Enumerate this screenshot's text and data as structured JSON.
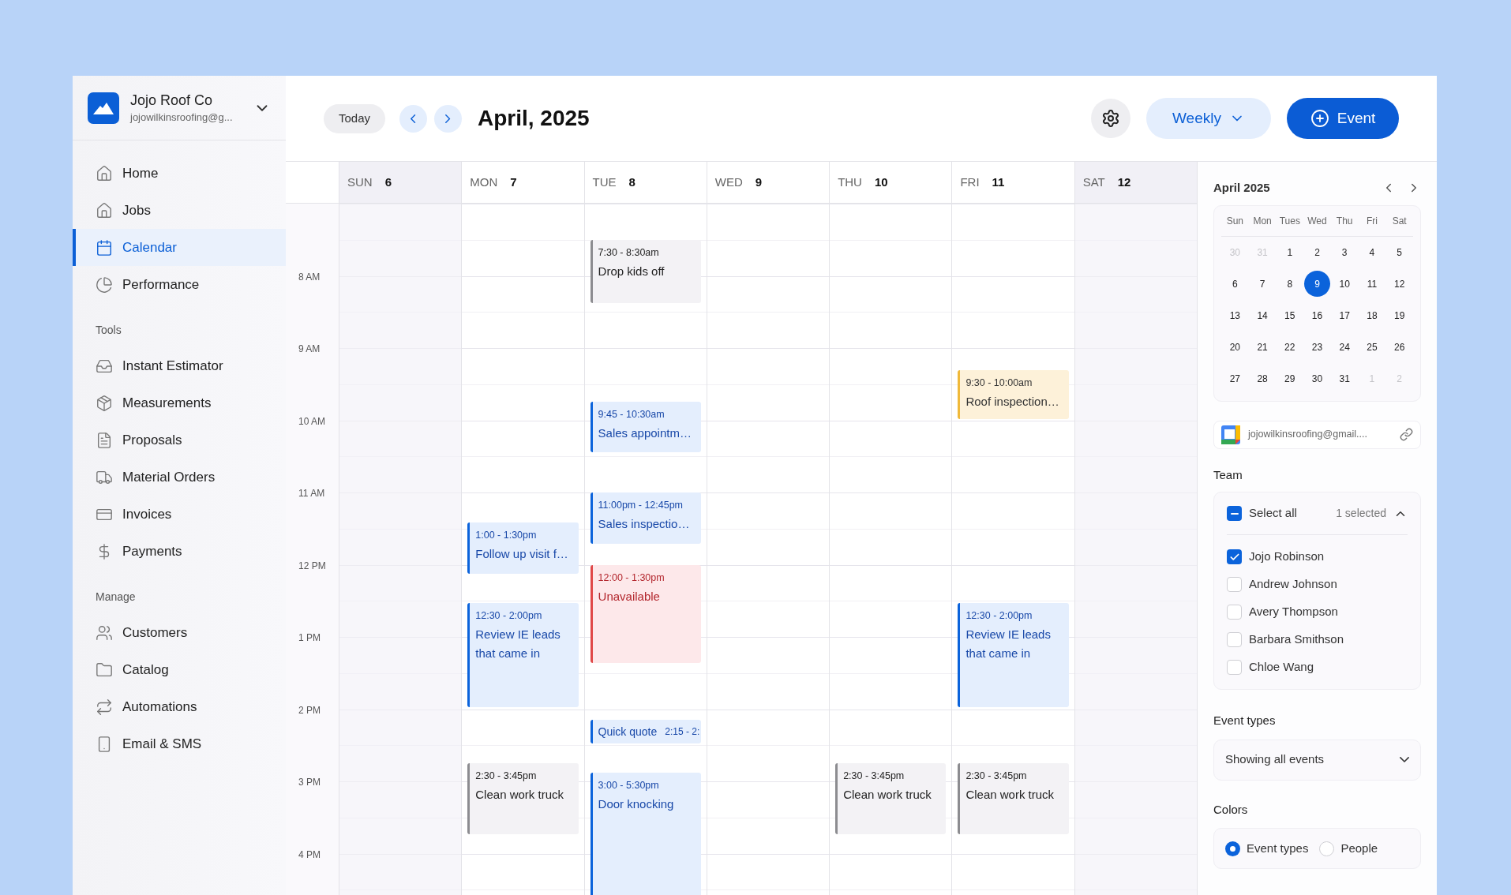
{
  "account": {
    "name": "Jojo Roof Co",
    "email": "jojowilkinsroofing@g..."
  },
  "nav": [
    {
      "items": [
        {
          "label": "Home",
          "selected": false
        },
        {
          "label": "Jobs",
          "selected": false
        },
        {
          "label": "Calendar",
          "selected": true
        },
        {
          "label": "Performance",
          "selected": false
        }
      ]
    },
    {
      "heading": "Tools",
      "items": [
        {
          "label": "Instant Estimator",
          "selected": false
        },
        {
          "label": "Measurements",
          "selected": false
        },
        {
          "label": "Proposals",
          "selected": false
        },
        {
          "label": "Material Orders",
          "selected": false
        },
        {
          "label": "Invoices",
          "selected": false
        },
        {
          "label": "Payments",
          "selected": false
        }
      ]
    },
    {
      "heading": "Manage",
      "items": [
        {
          "label": "Customers",
          "selected": false
        },
        {
          "label": "Catalog",
          "selected": false
        },
        {
          "label": "Automations",
          "selected": false
        },
        {
          "label": "Email & SMS",
          "selected": false
        }
      ]
    }
  ],
  "toolbar": {
    "today": "Today",
    "title": "April, 2025",
    "view": "Weekly",
    "add": "Event"
  },
  "hours": [
    "8 AM",
    "9 AM",
    "10 AM",
    "11 AM",
    "12 PM",
    "1 PM",
    "2 PM",
    "3 PM",
    "4 PM"
  ],
  "days": [
    {
      "name": "SUN",
      "date": "6",
      "weekend": true
    },
    {
      "name": "MON",
      "date": "7",
      "weekend": false,
      "events": [
        {
          "kind": "blue",
          "time": "1:00 - 1:30pm",
          "title": "Follow up visit f…"
        },
        {
          "kind": "blue",
          "time": "12:30 - 2:00pm",
          "title": "Review IE leads that came in"
        },
        {
          "kind": "gray",
          "time": "2:30 - 3:45pm",
          "title": "Clean work truck"
        }
      ]
    },
    {
      "name": "TUE",
      "date": "8",
      "weekend": false,
      "events": [
        {
          "kind": "gray",
          "time": "7:30 - 8:30am",
          "title": "Drop kids off"
        },
        {
          "kind": "blue",
          "time": "9:45 - 10:30am",
          "title": "Sales appointm…"
        },
        {
          "kind": "blue",
          "time": "11:00pm - 12:45pm",
          "title": "Sales inspectio…"
        },
        {
          "kind": "red",
          "time": "12:00 - 1:30pm",
          "title": "Unavailable"
        },
        {
          "kind": "inline",
          "time": "2:15 - 2:",
          "title": "Quick quote"
        },
        {
          "kind": "blue",
          "time": "3:00 - 5:30pm",
          "title": "Door knocking"
        }
      ]
    },
    {
      "name": "WED",
      "date": "9",
      "weekend": false
    },
    {
      "name": "THU",
      "date": "10",
      "weekend": false,
      "events": [
        {
          "kind": "gray",
          "time": "2:30 - 3:45pm",
          "title": "Clean work truck"
        }
      ]
    },
    {
      "name": "FRI",
      "date": "11",
      "weekend": false,
      "events": [
        {
          "kind": "yellow",
          "time": "9:30 - 10:00am",
          "title": "Roof inspection…"
        },
        {
          "kind": "blue",
          "time": "12:30 - 2:00pm",
          "title": "Review IE leads that came in"
        },
        {
          "kind": "gray",
          "time": "2:30 - 3:45pm",
          "title": "Clean work truck"
        }
      ]
    },
    {
      "name": "SAT",
      "date": "12",
      "weekend": true
    }
  ],
  "mini_calendar": {
    "title": "April 2025",
    "weekdays": [
      "Sun",
      "Mon",
      "Tues",
      "Wed",
      "Thu",
      "Fri",
      "Sat"
    ],
    "weeks": [
      [
        {
          "label": "30",
          "muted": true,
          "selected": false
        },
        {
          "label": "31",
          "muted": true,
          "selected": false
        },
        {
          "label": "1",
          "muted": false,
          "selected": false
        },
        {
          "label": "2",
          "muted": false,
          "selected": false
        },
        {
          "label": "3",
          "muted": false,
          "selected": false
        },
        {
          "label": "4",
          "muted": false,
          "selected": false
        },
        {
          "label": "5",
          "muted": false,
          "selected": false
        }
      ],
      [
        {
          "label": "6",
          "muted": false,
          "selected": false
        },
        {
          "label": "7",
          "muted": false,
          "selected": false
        },
        {
          "label": "8",
          "muted": false,
          "selected": false
        },
        {
          "label": "9",
          "muted": false,
          "selected": true
        },
        {
          "label": "10",
          "muted": false,
          "selected": false
        },
        {
          "label": "11",
          "muted": false,
          "selected": false
        },
        {
          "label": "12",
          "muted": false,
          "selected": false
        }
      ],
      [
        {
          "label": "13",
          "muted": false,
          "selected": false
        },
        {
          "label": "14",
          "muted": false,
          "selected": false
        },
        {
          "label": "15",
          "muted": false,
          "selected": false
        },
        {
          "label": "16",
          "muted": false,
          "selected": false
        },
        {
          "label": "17",
          "muted": false,
          "selected": false
        },
        {
          "label": "18",
          "muted": false,
          "selected": false
        },
        {
          "label": "19",
          "muted": false,
          "selected": false
        }
      ],
      [
        {
          "label": "20",
          "muted": false,
          "selected": false
        },
        {
          "label": "21",
          "muted": false,
          "selected": false
        },
        {
          "label": "22",
          "muted": false,
          "selected": false
        },
        {
          "label": "23",
          "muted": false,
          "selected": false
        },
        {
          "label": "24",
          "muted": false,
          "selected": false
        },
        {
          "label": "25",
          "muted": false,
          "selected": false
        },
        {
          "label": "26",
          "muted": false,
          "selected": false
        }
      ],
      [
        {
          "label": "27",
          "muted": false,
          "selected": false
        },
        {
          "label": "28",
          "muted": false,
          "selected": false
        },
        {
          "label": "29",
          "muted": false,
          "selected": false
        },
        {
          "label": "30",
          "muted": false,
          "selected": false
        },
        {
          "label": "31",
          "muted": false,
          "selected": false
        },
        {
          "label": "1",
          "muted": true,
          "selected": false
        },
        {
          "label": "2",
          "muted": true,
          "selected": false
        }
      ]
    ]
  },
  "linked_calendar": "jojowilkinsroofing@gmail....",
  "team": {
    "label": "Team",
    "select_all": {
      "label": "Select all",
      "indeterminate": true
    },
    "count": "1 selected",
    "expanded": true,
    "members": [
      {
        "name": "Jojo Robinson",
        "checked": true
      },
      {
        "name": "Andrew Johnson",
        "checked": false
      },
      {
        "name": "Avery Thompson",
        "checked": false
      },
      {
        "name": "Barbara Smithson",
        "checked": false
      },
      {
        "name": "Chloe Wang",
        "checked": false
      }
    ]
  },
  "event_types": {
    "label": "Event types",
    "value": "Showing all events"
  },
  "colors": {
    "label": "Colors",
    "options": [
      {
        "label": "Event types",
        "selected": true
      },
      {
        "label": "People",
        "selected": false
      }
    ]
  }
}
